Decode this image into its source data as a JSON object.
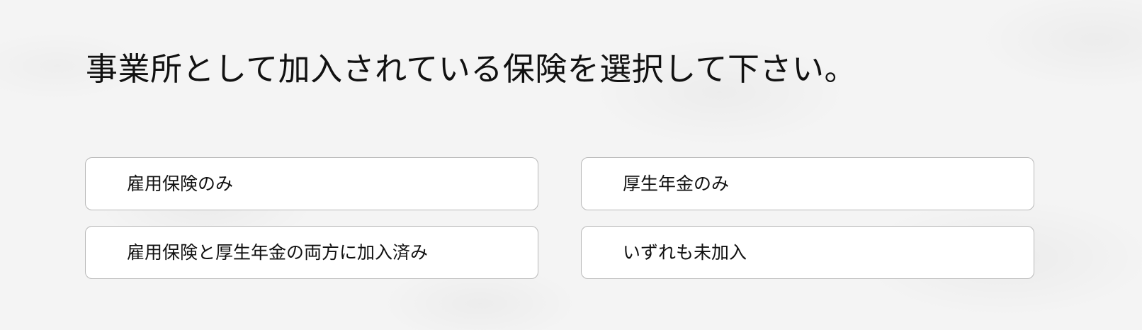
{
  "question": {
    "title": "事業所として加入されている保険を選択して下さい。"
  },
  "options": [
    {
      "label": "雇用保険のみ"
    },
    {
      "label": "厚生年金のみ"
    },
    {
      "label": "雇用保険と厚生年金の両方に加入済み"
    },
    {
      "label": "いずれも未加入"
    }
  ]
}
